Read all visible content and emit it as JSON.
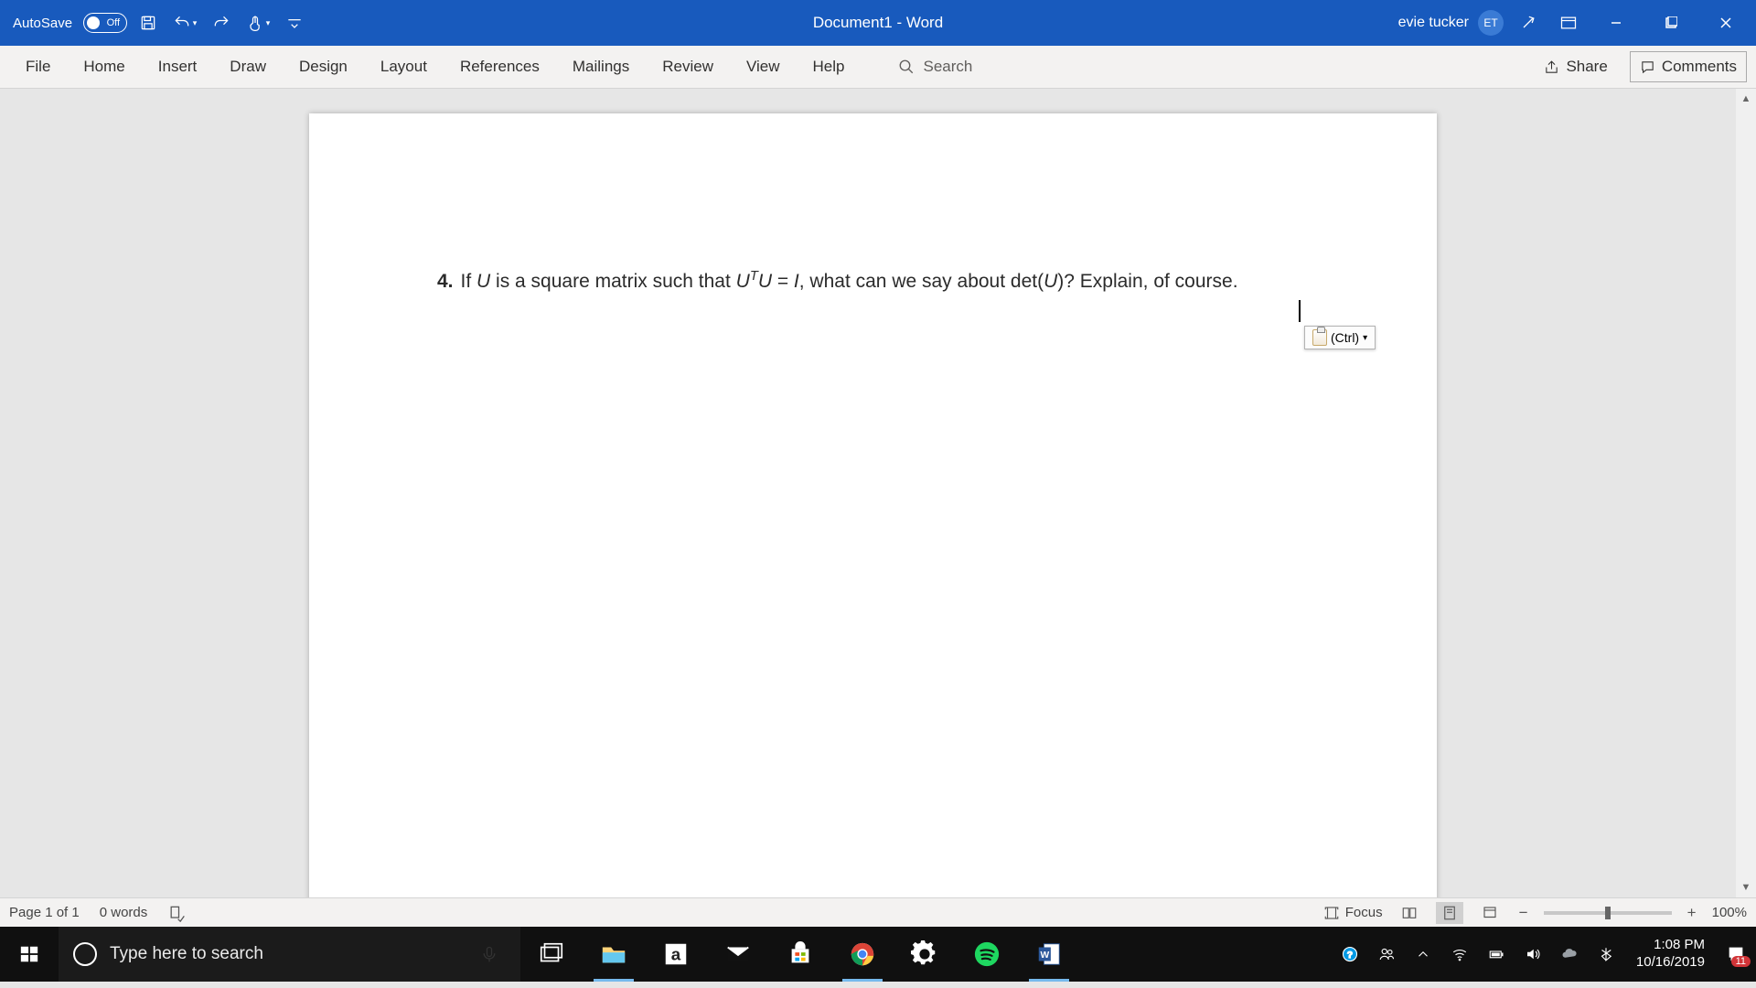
{
  "titlebar": {
    "autosave_label": "AutoSave",
    "autosave_state": "Off",
    "document_title": "Document1  -  Word",
    "username": "evie tucker",
    "user_initials": "ET"
  },
  "ribbon": {
    "tabs": [
      "File",
      "Home",
      "Insert",
      "Draw",
      "Design",
      "Layout",
      "References",
      "Mailings",
      "Review",
      "View",
      "Help"
    ],
    "search_placeholder": "Search",
    "share_label": "Share",
    "comments_label": "Comments"
  },
  "document": {
    "item_number": "4.",
    "text_before": "If ",
    "var1": "U",
    "text_mid1": " is a square matrix such that ",
    "expr_U": "U",
    "expr_T": "T",
    "expr_U2": "U",
    "expr_eq": " = ",
    "expr_I": "I",
    "text_after": ", what can we say about det(",
    "var2": "U",
    "text_end": ")? Explain, of course.",
    "paste_options_label": "(Ctrl)"
  },
  "statusbar": {
    "page_info": "Page 1 of 1",
    "word_count": "0 words",
    "focus_label": "Focus",
    "zoom_level": "100%"
  },
  "taskbar": {
    "search_placeholder": "Type here to search",
    "time": "1:08 PM",
    "date": "10/16/2019",
    "notification_count": "11"
  }
}
